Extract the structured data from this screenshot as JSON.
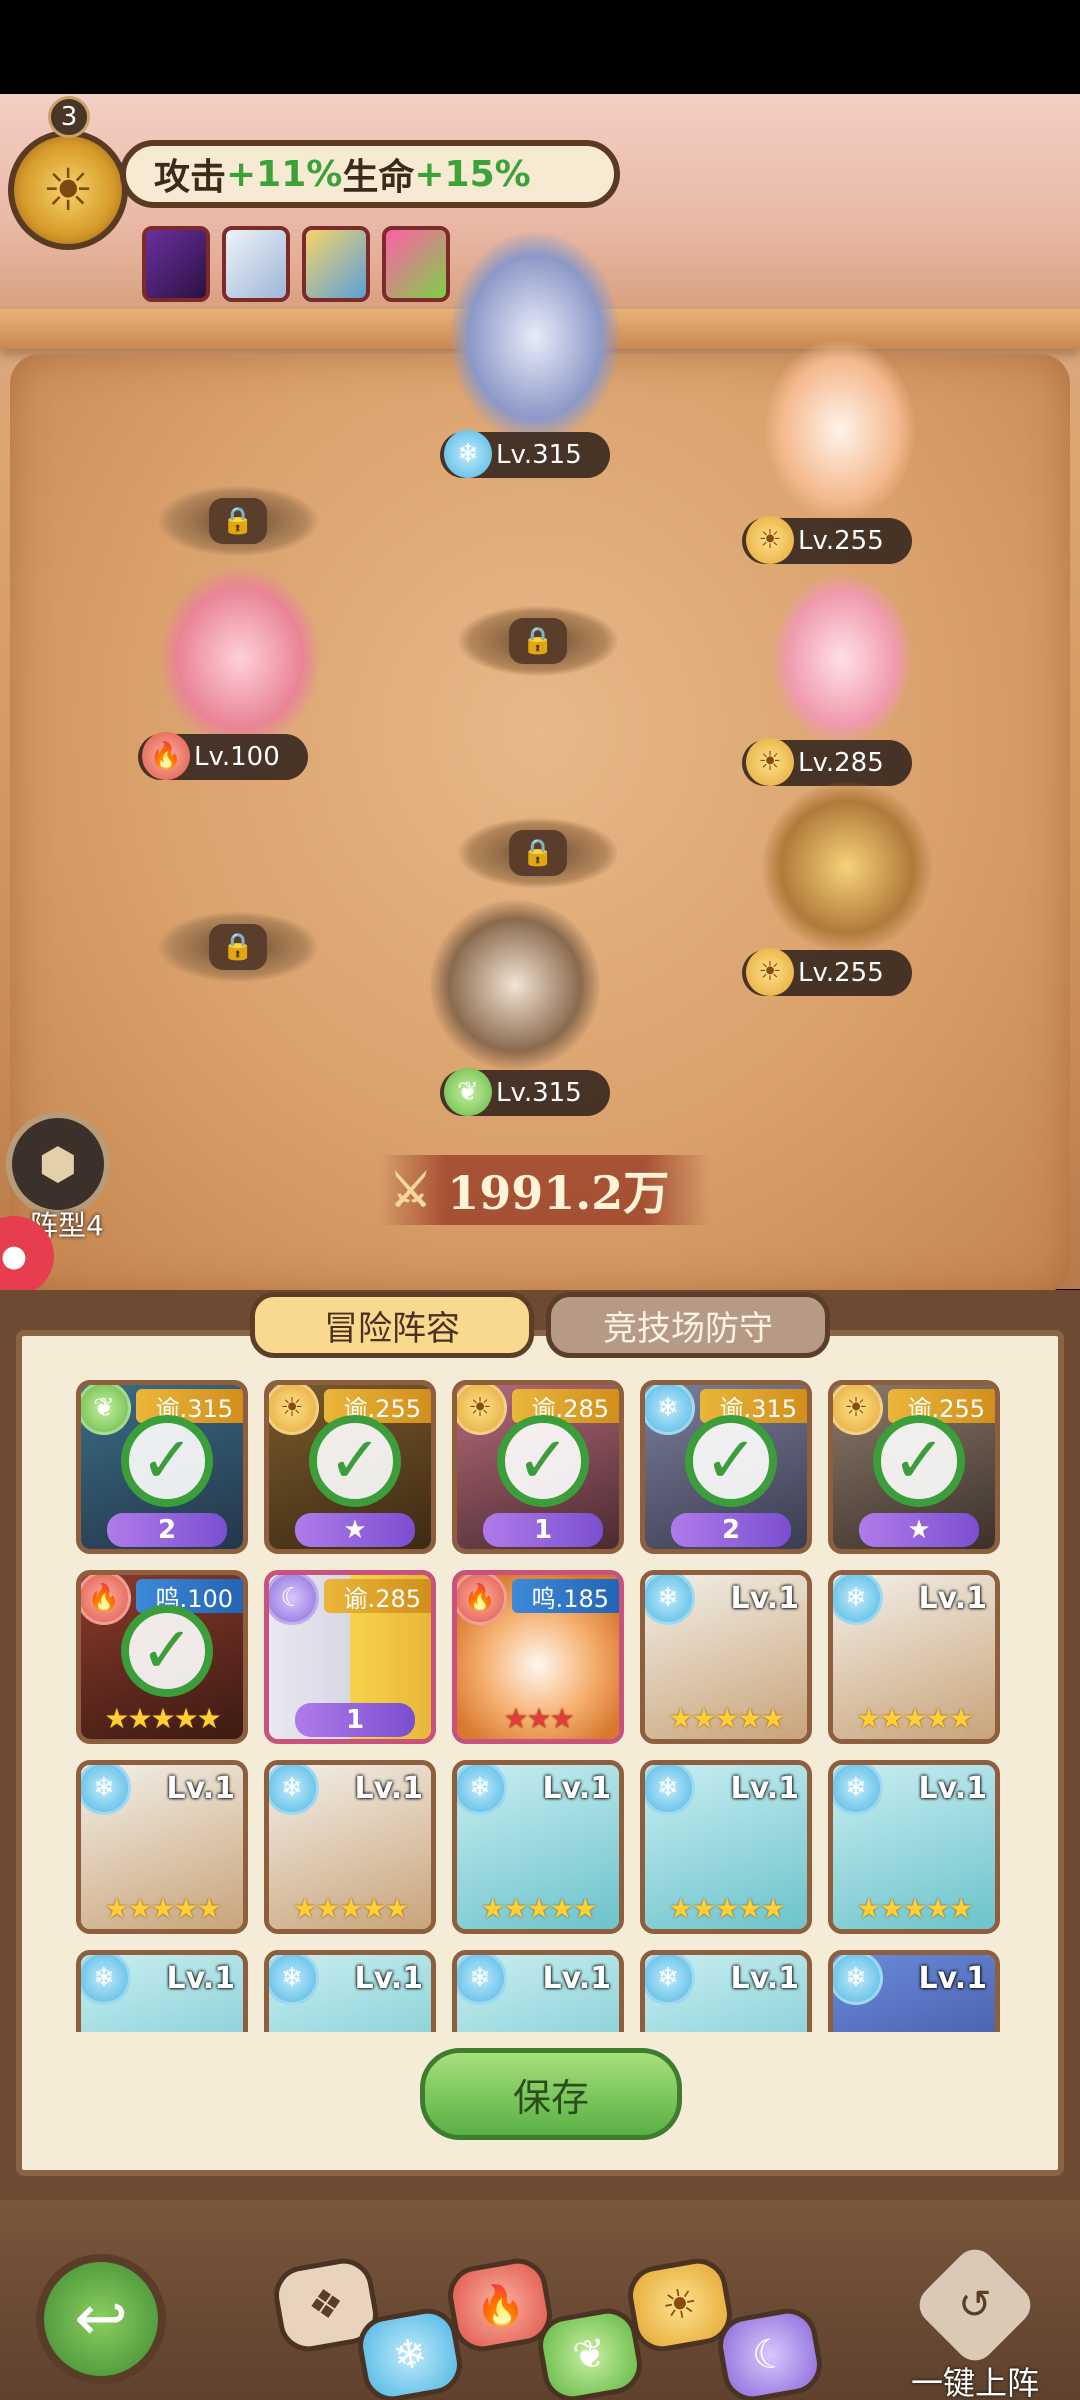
{
  "buff": {
    "count": "3",
    "label_prefix": "攻击",
    "attack_bonus": "+11%",
    "label_mid": "生命",
    "hp_bonus": "+15%"
  },
  "field": {
    "heroes": [
      {
        "level": "Lv.315",
        "element": "water"
      },
      {
        "level": "Lv.255",
        "element": "sun"
      },
      {
        "level": "Lv.100",
        "element": "fire"
      },
      {
        "level": "Lv.285",
        "element": "sun"
      },
      {
        "level": "Lv.255",
        "element": "sun"
      },
      {
        "level": "Lv.315",
        "element": "leaf"
      }
    ],
    "formation_label": "阵型4",
    "power": "1991.2万"
  },
  "tabs": {
    "adventure": "冒险阵容",
    "arena": "竞技场防守"
  },
  "roster": {
    "row1": [
      {
        "tag": "谕.315",
        "element": "leaf",
        "badge": "2"
      },
      {
        "tag": "谕.255",
        "element": "sun",
        "badge": ""
      },
      {
        "tag": "谕.285",
        "element": "sun",
        "badge": "1"
      },
      {
        "tag": "谕.315",
        "element": "water",
        "badge": "2"
      },
      {
        "tag": "谕.255",
        "element": "sun",
        "badge": ""
      }
    ],
    "row2": [
      {
        "tag": "鸣.100",
        "element": "fire",
        "stars": "★★★★★"
      },
      {
        "tag": "谕.285",
        "element": "moon",
        "badge": "1"
      },
      {
        "tag": "鸣.185",
        "element": "fire",
        "stars": "★★★"
      },
      {
        "tag": "Lv.1",
        "element": "water",
        "stars": "★★★★★"
      },
      {
        "tag": "Lv.1",
        "element": "water",
        "stars": "★★★★★"
      }
    ],
    "row3": [
      {
        "tag": "Lv.1",
        "stars": "★★★★★"
      },
      {
        "tag": "Lv.1",
        "stars": "★★★★★"
      },
      {
        "tag": "Lv.1",
        "stars": "★★★★★"
      },
      {
        "tag": "Lv.1",
        "stars": "★★★★★"
      },
      {
        "tag": "Lv.1",
        "stars": "★★★★★"
      }
    ],
    "row4": [
      {
        "tag": "Lv.1"
      },
      {
        "tag": "Lv.1"
      },
      {
        "tag": "Lv.1"
      },
      {
        "tag": "Lv.1"
      },
      {
        "tag": "Lv.1"
      }
    ]
  },
  "save_label": "保存",
  "one_key_label": "一键上阵",
  "colors": {
    "check": "#3c9e3a",
    "gold_tag": "#e0a52a",
    "blue_tag": "#2f76c6",
    "panel_bg": "#f5ecd8"
  }
}
